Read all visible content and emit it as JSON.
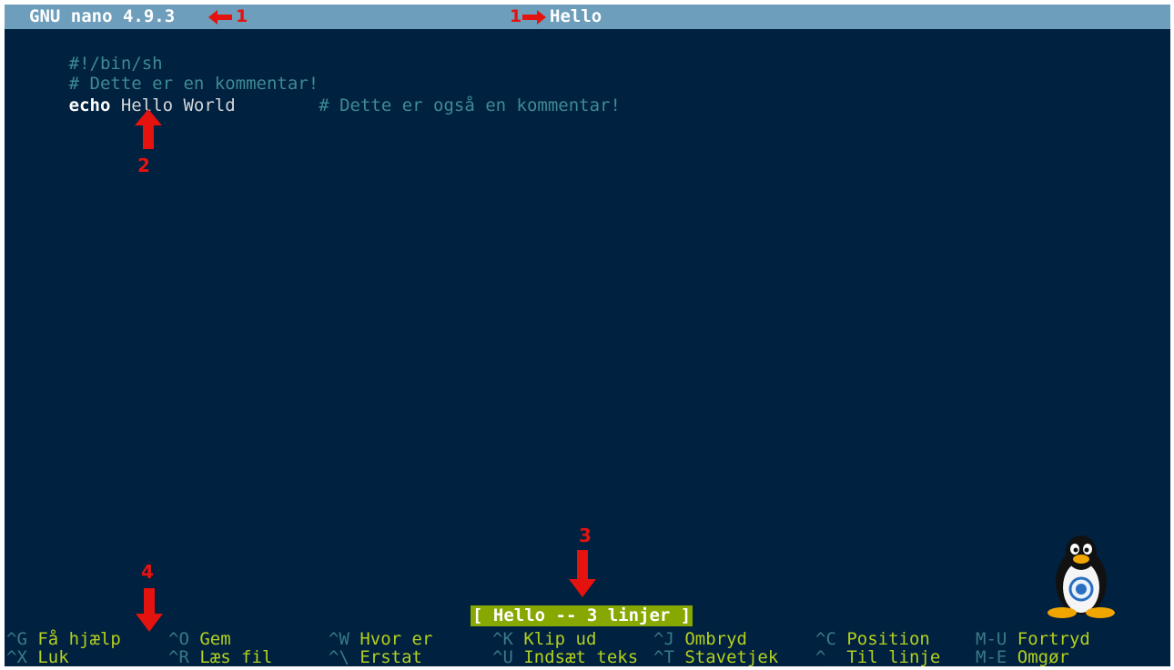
{
  "titlebar": {
    "app": "GNU nano 4.9.3",
    "filename": "Hello"
  },
  "editor": {
    "lines": [
      {
        "segments": [
          {
            "text": "#!/bin/sh",
            "kind": "comment"
          }
        ]
      },
      {
        "segments": [
          {
            "text": "# Dette er en kommentar!",
            "kind": "comment"
          }
        ]
      },
      {
        "segments": [
          {
            "text": "echo",
            "kind": "keyword"
          },
          {
            "text": " Hello World        ",
            "kind": "plain"
          },
          {
            "text": "# Dette er også en kommentar!",
            "kind": "comment"
          }
        ]
      }
    ]
  },
  "statusbar": {
    "message": "[ Hello -- 3 linjer ]"
  },
  "shortcuts": {
    "row1": [
      {
        "key": "^G",
        "label": "Få hjælp"
      },
      {
        "key": "^O",
        "label": "Gem"
      },
      {
        "key": "^W",
        "label": "Hvor er"
      },
      {
        "key": "^K",
        "label": "Klip ud"
      },
      {
        "key": "^J",
        "label": "Ombryd"
      },
      {
        "key": "^C",
        "label": "Position"
      },
      {
        "key": "M-U",
        "label": "Fortryd"
      }
    ],
    "row2": [
      {
        "key": "^X",
        "label": "Luk"
      },
      {
        "key": "^R",
        "label": "Læs fil"
      },
      {
        "key": "^\\",
        "label": "Erstat"
      },
      {
        "key": "^U",
        "label": "Indsæt teks"
      },
      {
        "key": "^T",
        "label": "Stavetjek"
      },
      {
        "key": "^_",
        "label": "Til linje"
      },
      {
        "key": "M-E",
        "label": "Omgør"
      }
    ]
  },
  "annotations": {
    "title_app_num": "1",
    "title_file_num": "1",
    "code_num": "2",
    "status_num": "3",
    "shortcut_num": "4"
  },
  "colors": {
    "background": "#00213f",
    "titlebar": "#6d9ebb",
    "statusbar": "#87a800",
    "comment": "#3e8a95",
    "shortcut_key": "#397a88",
    "shortcut_label": "#b3cf1f",
    "annotation": "#e4130f"
  }
}
